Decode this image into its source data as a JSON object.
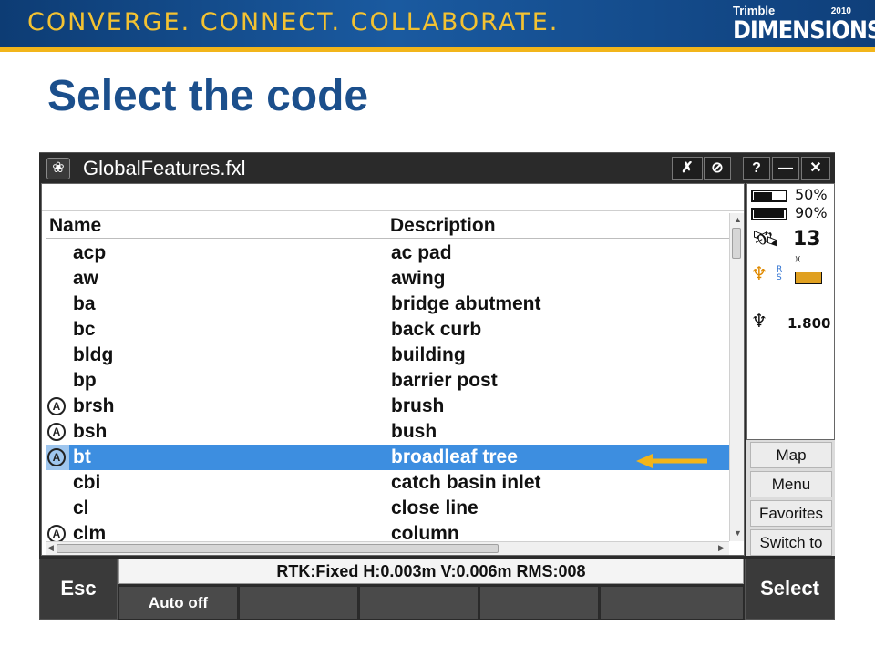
{
  "banner": {
    "tagline": "CONVERGE. CONNECT. COLLABORATE.",
    "brand_top": "Trimble",
    "brand_year": "2010",
    "brand_name": "DIMENSIONS"
  },
  "slide": {
    "title": "Select the code"
  },
  "window": {
    "title": "GlobalFeatures.fxl",
    "help_label": "?",
    "minimize_label": "—",
    "close_label": "✕"
  },
  "search": {
    "value": ""
  },
  "columns": {
    "name": "Name",
    "description": "Description"
  },
  "rows": [
    {
      "name": "acp",
      "description": "ac pad",
      "icon": ""
    },
    {
      "name": "aw",
      "description": "awing",
      "icon": ""
    },
    {
      "name": "ba",
      "description": "bridge abutment",
      "icon": ""
    },
    {
      "name": "bc",
      "description": "back curb",
      "icon": ""
    },
    {
      "name": "bldg",
      "description": "building",
      "icon": ""
    },
    {
      "name": "bp",
      "description": "barrier post",
      "icon": ""
    },
    {
      "name": "brsh",
      "description": "brush",
      "icon": "A"
    },
    {
      "name": "bsh",
      "description": "bush",
      "icon": "A"
    },
    {
      "name": "bt",
      "description": "broadleaf tree",
      "icon": "A",
      "selected": true
    },
    {
      "name": "cbi",
      "description": "catch basin inlet",
      "icon": ""
    },
    {
      "name": "cl",
      "description": "close line",
      "icon": ""
    },
    {
      "name": "clm",
      "description": "column",
      "icon": "A"
    }
  ],
  "status_panel": {
    "battery1": "50%",
    "battery2": "90%",
    "satellites": "13",
    "antenna_height": "1.800",
    "rover_label": "R\nS"
  },
  "side_buttons": {
    "map": "Map",
    "menu": "Menu",
    "favorites": "Favorites",
    "switch_to": "Switch to"
  },
  "bottom": {
    "esc": "Esc",
    "select": "Select",
    "auto_off": "Auto off",
    "status": "RTK:Fixed H:0.003m V:0.006m RMS:008"
  },
  "colors": {
    "selection": "#3d8ee0",
    "arrow": "#f2b51a",
    "title": "#1b4f8c",
    "banner": "#1a5aa0"
  }
}
